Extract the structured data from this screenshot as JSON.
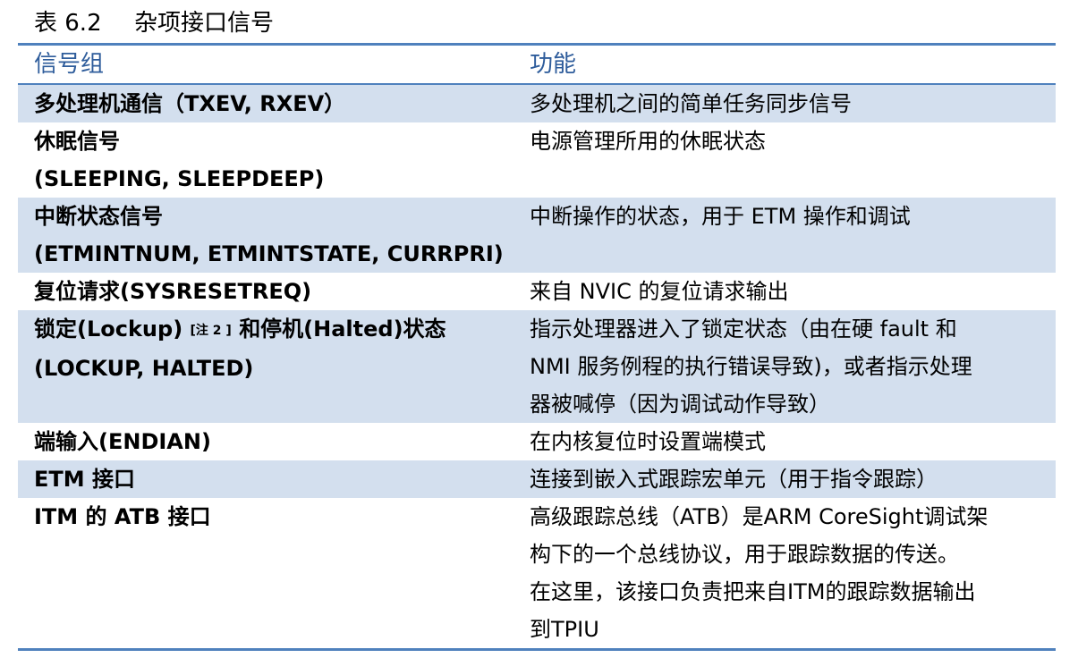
{
  "caption": {
    "number": "表 6.2",
    "title": "杂项接口信号"
  },
  "table": {
    "headers": [
      "信号组",
      "功能"
    ],
    "rows": [
      {
        "signal": [
          "多处理机通信（TXEV, RXEV）"
        ],
        "function": [
          "多处理机之间的简单任务同步信号"
        ]
      },
      {
        "signal": [
          "休眠信号",
          "(SLEEPING, SLEEPDEEP)"
        ],
        "function": [
          "电源管理所用的休眠状态"
        ]
      },
      {
        "signal": [
          "中断状态信号",
          "(ETMINTNUM, ETMINTSTATE, CURRPRI)"
        ],
        "function": [
          "中断操作的状态，用于 ETM 操作和调试"
        ]
      },
      {
        "signal": [
          "复位请求(SYSRESETREQ)"
        ],
        "function": [
          "来自 NVIC 的复位请求输出"
        ]
      },
      {
        "signal_parts": {
          "a": "锁定(Lockup)",
          "note": "[注 2 ]",
          "b": "和停机(Halted)状态",
          "line2": "(LOCKUP, HALTED)"
        },
        "function": [
          "指示处理器进入了锁定状态（由在硬 fault 和",
          "NMI 服务例程的执行错误导致)，或者指示处理",
          "器被喊停（因为调试动作导致）"
        ]
      },
      {
        "signal": [
          "端输入(ENDIAN)"
        ],
        "function": [
          "在内核复位时设置端模式"
        ]
      },
      {
        "signal": [
          "ETM 接口"
        ],
        "function": [
          "连接到嵌入式跟踪宏单元（用于指令跟踪）"
        ]
      },
      {
        "signal": [
          "ITM 的 ATB 接口"
        ],
        "function": [
          "高级跟踪总线（ATB）是ARM CoreSight调试架",
          "构下的一个总线协议，用于跟踪数据的传送。",
          "在这里，该接口负责把来自ITM的跟踪数据输出",
          "到TPIU"
        ]
      }
    ]
  },
  "colors": {
    "rule": "#4f81bd",
    "header_text": "#2e5c9b",
    "shade": "#d3dfee"
  }
}
